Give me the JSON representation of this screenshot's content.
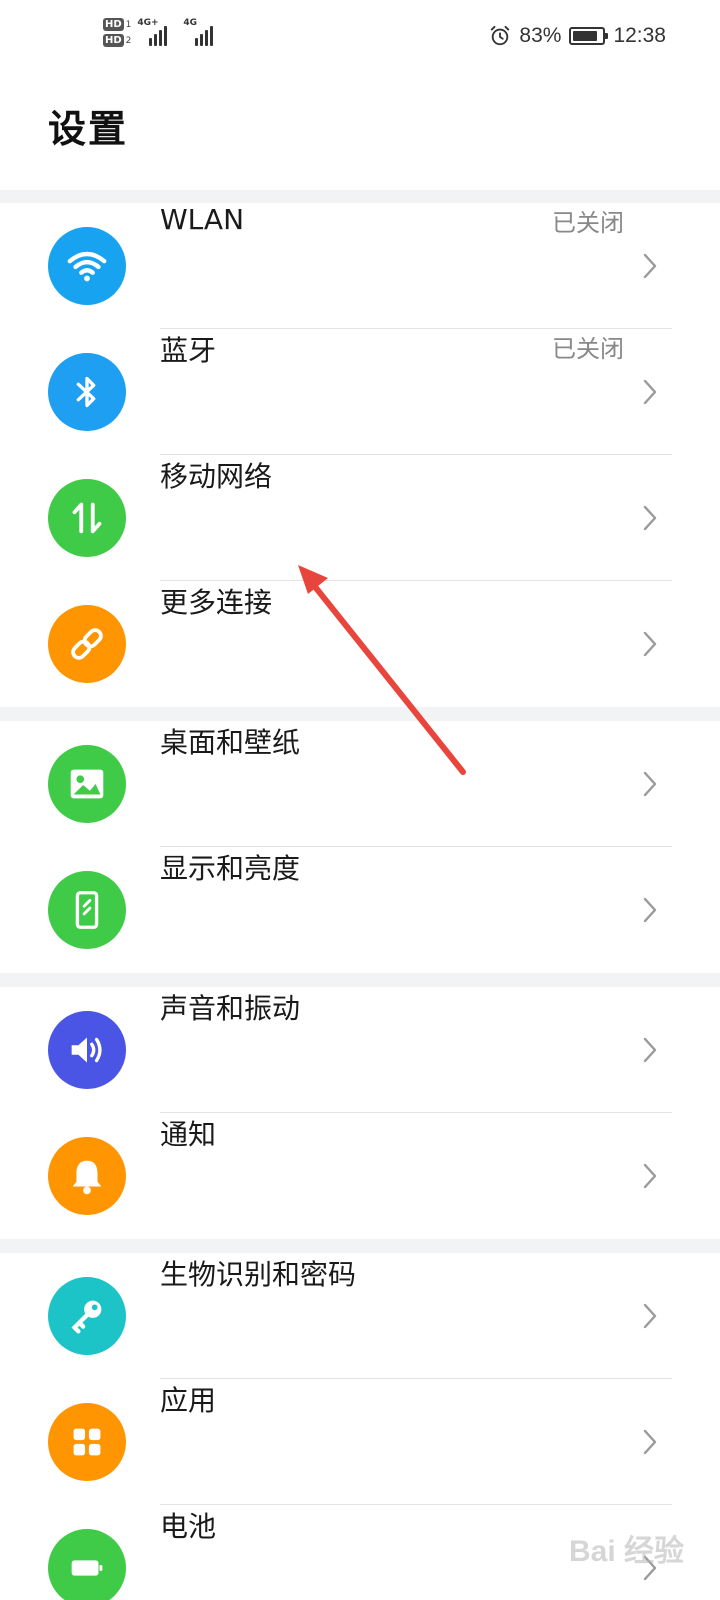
{
  "status_bar": {
    "sim1_badge": "HD",
    "sim1_num": "1",
    "sim2_badge": "HD",
    "sim2_num": "2",
    "net1": "4G+",
    "net2": "4G",
    "battery_percent": "83%",
    "battery_level": 0.83,
    "time": "12:38",
    "icons": [
      "alarm-icon",
      "battery-icon",
      "signal-icon"
    ]
  },
  "header": {
    "title": "设置"
  },
  "groups": [
    {
      "items": [
        {
          "label": "WLAN",
          "value": "已关闭",
          "icon": "wifi-icon",
          "color": "#18a3f0"
        },
        {
          "label": "蓝牙",
          "value": "已关闭",
          "icon": "bluetooth-icon",
          "color": "#1e9ff2"
        },
        {
          "label": "移动网络",
          "value": "",
          "icon": "mobile-data-icon",
          "color": "#3fcb48"
        },
        {
          "label": "更多连接",
          "value": "",
          "icon": "link-icon",
          "color": "#ff9500"
        }
      ]
    },
    {
      "items": [
        {
          "label": "桌面和壁纸",
          "value": "",
          "icon": "wallpaper-icon",
          "color": "#3fcb48"
        },
        {
          "label": "显示和亮度",
          "value": "",
          "icon": "display-icon",
          "color": "#3fcb48"
        }
      ]
    },
    {
      "items": [
        {
          "label": "声音和振动",
          "value": "",
          "icon": "sound-icon",
          "color": "#4a55e6"
        },
        {
          "label": "通知",
          "value": "",
          "icon": "bell-icon",
          "color": "#ff9500"
        }
      ]
    },
    {
      "items": [
        {
          "label": "生物识别和密码",
          "value": "",
          "icon": "key-icon",
          "color": "#1cc4c8"
        },
        {
          "label": "应用",
          "value": "",
          "icon": "apps-icon",
          "color": "#ff9500"
        },
        {
          "label": "电池",
          "value": "",
          "icon": "battery-icon",
          "color": "#3fcb48"
        }
      ]
    }
  ],
  "watermark": "Bai 经验"
}
